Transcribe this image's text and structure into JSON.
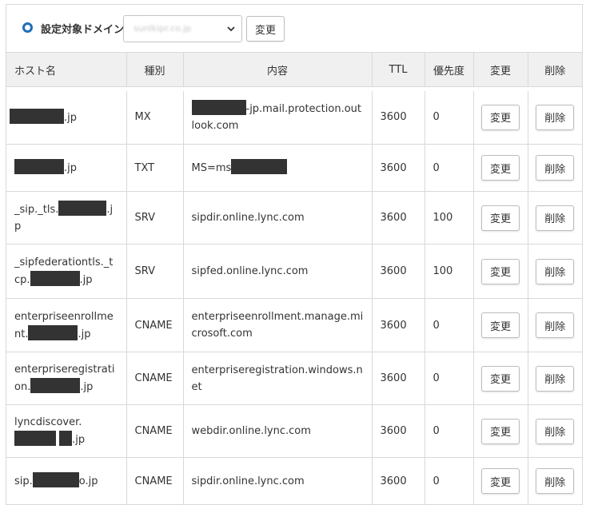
{
  "domain_bar": {
    "label": "設定対象ドメイン",
    "selected_domain": "sunlkipr.co.jp",
    "change_label": "変更"
  },
  "table": {
    "headers": {
      "host": "ホスト名",
      "type": "種別",
      "content": "内容",
      "ttl": "TTL",
      "priority": "優先度",
      "change": "変更",
      "delete": "削除"
    },
    "rows": [
      {
        "host_prefix": "",
        "host_suffix": ".jp",
        "type": "MX",
        "content_prefix": "",
        "content_suffix": "-jp.mail.protection.outlook.com",
        "ttl": "3600",
        "priority": "0",
        "change": "変更",
        "delete": "削除"
      },
      {
        "host_prefix": "",
        "host_suffix": ".jp",
        "type": "TXT",
        "content_prefix": "MS=ms",
        "content_suffix": "",
        "ttl": "3600",
        "priority": "0",
        "change": "変更",
        "delete": "削除"
      },
      {
        "host_prefix": "_sip._tls.",
        "host_suffix": ".jp",
        "type": "SRV",
        "content_prefix": "sipdir.online.lync.com",
        "content_suffix": "",
        "ttl": "3600",
        "priority": "100",
        "change": "変更",
        "delete": "削除"
      },
      {
        "host_prefix": "_sipfederationtls._tcp.",
        "host_suffix": ".jp",
        "type": "SRV",
        "content_prefix": "sipfed.online.lync.com",
        "content_suffix": "",
        "ttl": "3600",
        "priority": "100",
        "change": "変更",
        "delete": "削除"
      },
      {
        "host_prefix": "enterpriseenrollment.",
        "host_suffix": ".jp",
        "type": "CNAME",
        "content_prefix": "enterpriseenrollment.manage.microsoft.com",
        "content_suffix": "",
        "ttl": "3600",
        "priority": "0",
        "change": "変更",
        "delete": "削除"
      },
      {
        "host_prefix": "enterpriseregistration.",
        "host_suffix": ".jp",
        "type": "CNAME",
        "content_prefix": "enterpriseregistration.windows.net",
        "content_suffix": "",
        "ttl": "3600",
        "priority": "0",
        "change": "変更",
        "delete": "削除"
      },
      {
        "host_prefix": "lyncdiscover.",
        "host_suffix": ".jp",
        "type": "CNAME",
        "content_prefix": "webdir.online.lync.com",
        "content_suffix": "",
        "ttl": "3600",
        "priority": "0",
        "change": "変更",
        "delete": "削除"
      },
      {
        "host_prefix": "sip.",
        "host_suffix": "o.jp",
        "type": "CNAME",
        "content_prefix": "sipdir.online.lync.com",
        "content_suffix": "",
        "ttl": "3600",
        "priority": "0",
        "change": "変更",
        "delete": "削除"
      }
    ]
  },
  "colors": {
    "radio_accent": "#1e6fb8",
    "header_bg": "#f0f0f0",
    "border": "#d9d9d9",
    "redaction": "#333333"
  },
  "icons": {
    "radio": "radio-selected-icon",
    "select_chevron": "chevron-down-icon"
  }
}
